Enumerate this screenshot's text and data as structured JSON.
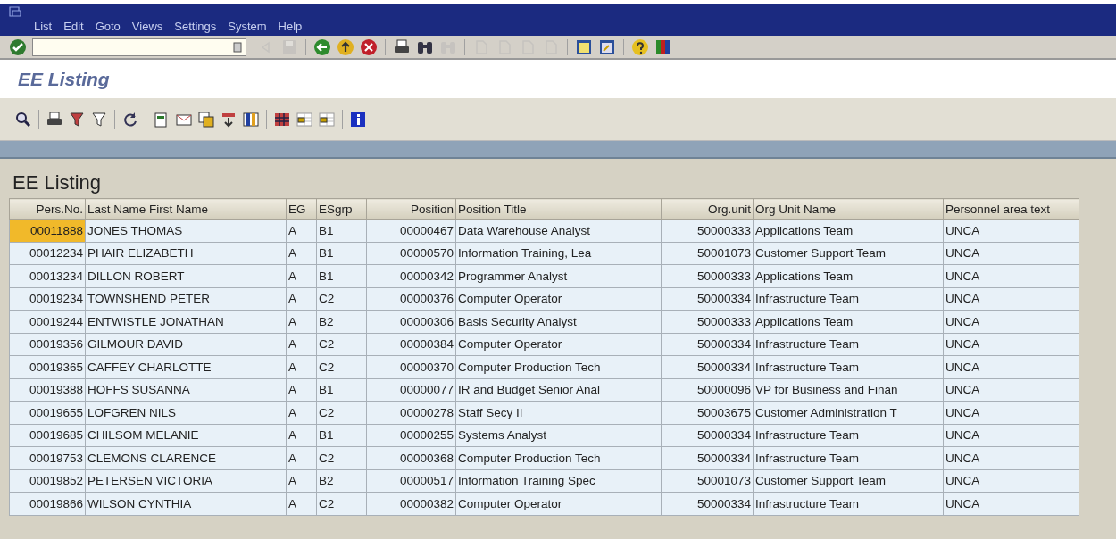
{
  "menu": [
    {
      "label": "List"
    },
    {
      "label": "Edit"
    },
    {
      "label": "Goto"
    },
    {
      "label": "Views"
    },
    {
      "label": "Settings"
    },
    {
      "label": "System"
    },
    {
      "label": "Help"
    }
  ],
  "system_toolbar": [
    {
      "kind": "enter",
      "disabled": false
    },
    {
      "kind": "field"
    },
    {
      "kind": "triangle",
      "disabled": true
    },
    {
      "kind": "save",
      "disabled": true
    },
    {
      "kind": "sep"
    },
    {
      "kind": "back",
      "disabled": false
    },
    {
      "kind": "exit",
      "disabled": false
    },
    {
      "kind": "cancel",
      "disabled": false
    },
    {
      "kind": "sep"
    },
    {
      "kind": "print",
      "disabled": false
    },
    {
      "kind": "find",
      "disabled": false
    },
    {
      "kind": "find",
      "disabled": true
    },
    {
      "kind": "sep"
    },
    {
      "kind": "page",
      "disabled": true
    },
    {
      "kind": "page",
      "disabled": true
    },
    {
      "kind": "page",
      "disabled": true
    },
    {
      "kind": "page",
      "disabled": true
    },
    {
      "kind": "sep"
    },
    {
      "kind": "window",
      "disabled": false
    },
    {
      "kind": "shortcut",
      "disabled": false
    },
    {
      "kind": "sep"
    },
    {
      "kind": "help",
      "disabled": false
    },
    {
      "kind": "layout",
      "disabled": false
    }
  ],
  "screen_title": "EE Listing",
  "app_toolbar": [
    {
      "kind": "detail"
    },
    {
      "kind": "sep"
    },
    {
      "kind": "print"
    },
    {
      "kind": "filter"
    },
    {
      "kind": "filter-off"
    },
    {
      "kind": "sep"
    },
    {
      "kind": "refresh"
    },
    {
      "kind": "sep"
    },
    {
      "kind": "export"
    },
    {
      "kind": "mail"
    },
    {
      "kind": "copy"
    },
    {
      "kind": "sort"
    },
    {
      "kind": "columns"
    },
    {
      "kind": "sep"
    },
    {
      "kind": "grid"
    },
    {
      "kind": "grid-select"
    },
    {
      "kind": "grid-select"
    },
    {
      "kind": "sep"
    },
    {
      "kind": "info"
    }
  ],
  "list_title": "EE Listing",
  "table": {
    "columns": [
      {
        "label": "Pers.No.",
        "kind": "number"
      },
      {
        "label": "Last Name First Name",
        "kind": "text"
      },
      {
        "label": "EG",
        "kind": "text"
      },
      {
        "label": "ESgrp",
        "kind": "text"
      },
      {
        "label": "Position",
        "kind": "number"
      },
      {
        "label": "Position Title",
        "kind": "text"
      },
      {
        "label": "Org.unit",
        "kind": "number"
      },
      {
        "label": "Org Unit Name",
        "kind": "text"
      },
      {
        "label": "Personnel area text",
        "kind": "text"
      }
    ],
    "rows": [
      {
        "focused": true,
        "cells": [
          "00011888",
          "JONES THOMAS",
          "A",
          "B1",
          "00000467",
          "Data Warehouse Analyst",
          "50000333",
          "Applications Team",
          "UNCA"
        ]
      },
      {
        "focused": false,
        "cells": [
          "00012234",
          "PHAIR ELIZABETH",
          "A",
          "B1",
          "00000570",
          "Information Training, Lea",
          "50001073",
          "Customer Support Team",
          "UNCA"
        ]
      },
      {
        "focused": false,
        "cells": [
          "00013234",
          "DILLON ROBERT",
          "A",
          "B1",
          "00000342",
          "Programmer Analyst",
          "50000333",
          "Applications Team",
          "UNCA"
        ]
      },
      {
        "focused": false,
        "cells": [
          "00019234",
          "TOWNSHEND PETER",
          "A",
          "C2",
          "00000376",
          "Computer Operator",
          "50000334",
          "Infrastructure Team",
          "UNCA"
        ]
      },
      {
        "focused": false,
        "cells": [
          "00019244",
          "ENTWISTLE JONATHAN",
          "A",
          "B2",
          "00000306",
          "Basis Security Analyst",
          "50000333",
          "Applications Team",
          "UNCA"
        ]
      },
      {
        "focused": false,
        "cells": [
          "00019356",
          "GILMOUR DAVID",
          "A",
          "C2",
          "00000384",
          "Computer Operator",
          "50000334",
          "Infrastructure Team",
          "UNCA"
        ]
      },
      {
        "focused": false,
        "cells": [
          "00019365",
          "CAFFEY CHARLOTTE",
          "A",
          "C2",
          "00000370",
          "Computer Production Tech",
          "50000334",
          "Infrastructure Team",
          "UNCA"
        ]
      },
      {
        "focused": false,
        "cells": [
          "00019388",
          "HOFFS SUSANNA",
          "A",
          "B1",
          "00000077",
          "IR and Budget Senior Anal",
          "50000096",
          "VP for Business and Finan",
          "UNCA"
        ]
      },
      {
        "focused": false,
        "cells": [
          "00019655",
          "LOFGREN NILS",
          "A",
          "C2",
          "00000278",
          "Staff Secy II",
          "50003675",
          "Customer Administration T",
          "UNCA"
        ]
      },
      {
        "focused": false,
        "cells": [
          "00019685",
          "CHILSOM MELANIE",
          "A",
          "B1",
          "00000255",
          "Systems Analyst",
          "50000334",
          "Infrastructure Team",
          "UNCA"
        ]
      },
      {
        "focused": false,
        "cells": [
          "00019753",
          "CLEMONS CLARENCE",
          "A",
          "C2",
          "00000368",
          "Computer Production Tech",
          "50000334",
          "Infrastructure Team",
          "UNCA"
        ]
      },
      {
        "focused": false,
        "cells": [
          "00019852",
          "PETERSEN VICTORIA",
          "A",
          "B2",
          "00000517",
          "Information Training Spec",
          "50001073",
          "Customer Support Team",
          "UNCA"
        ]
      },
      {
        "focused": false,
        "cells": [
          "00019866",
          "WILSON CYNTHIA",
          "A",
          "C2",
          "00000382",
          "Computer Operator",
          "50000334",
          "Infrastructure Team",
          "UNCA"
        ]
      }
    ]
  }
}
